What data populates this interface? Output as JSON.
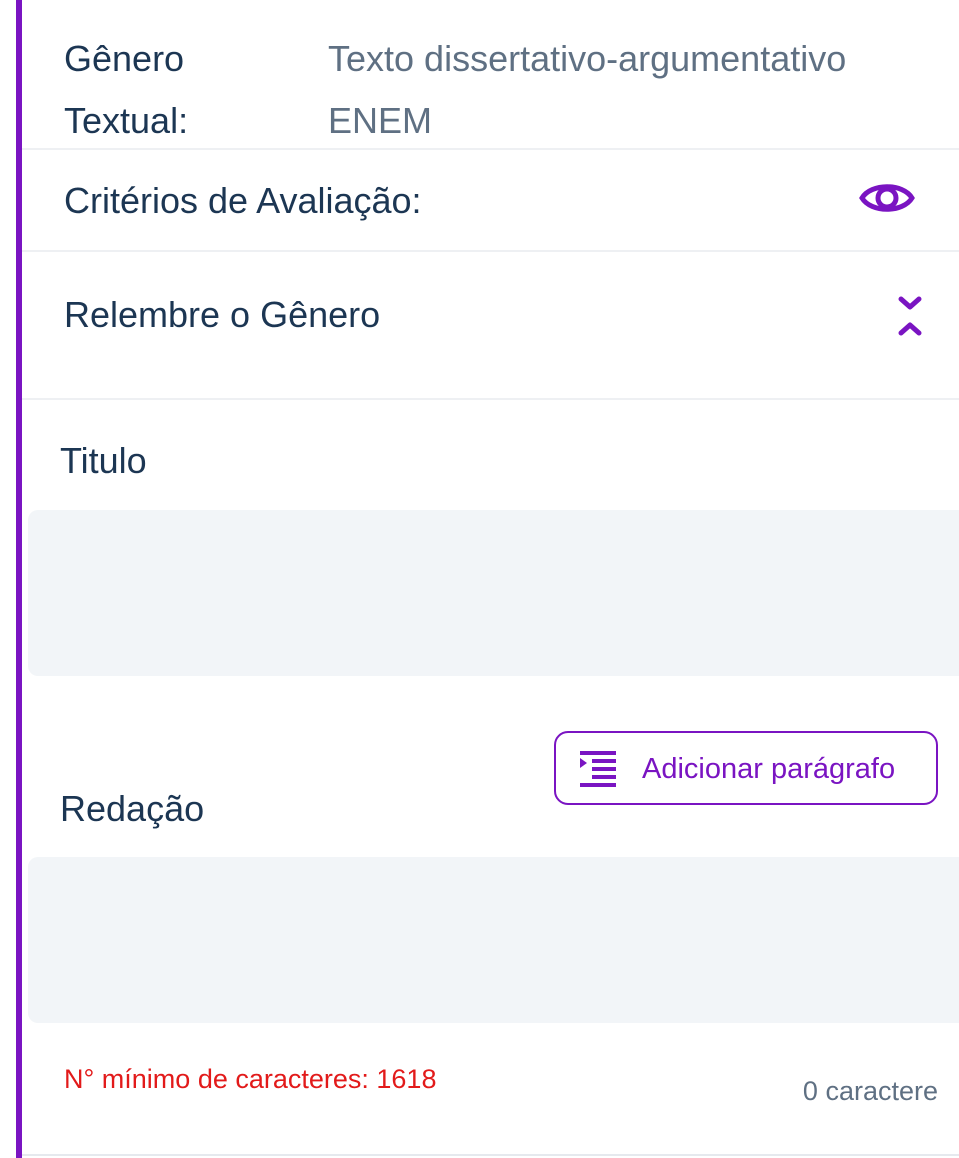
{
  "genre": {
    "label": "Gênero Textual:",
    "value": "Texto dissertativo-argumentativo ENEM"
  },
  "criteria": {
    "label": "Critérios de Avaliação:",
    "icon": "eye-icon"
  },
  "genre_review": {
    "label": "Relembre o Gênero",
    "icon": "expand-collapse-icon"
  },
  "title_field": {
    "label": "Titulo",
    "value": ""
  },
  "essay_field": {
    "label": "Redação",
    "value": ""
  },
  "add_paragraph": {
    "label": "Adicionar parágrafo",
    "icon": "indent-icon"
  },
  "counter": {
    "minimum_text": "N° mínimo de caracteres: 1618",
    "count_text": "0 caractere"
  },
  "colors": {
    "accent": "#7a14c2",
    "heading": "#1c3653",
    "muted": "#5f7083",
    "error": "#e21a1a",
    "field_background": "#f2f5f8"
  }
}
